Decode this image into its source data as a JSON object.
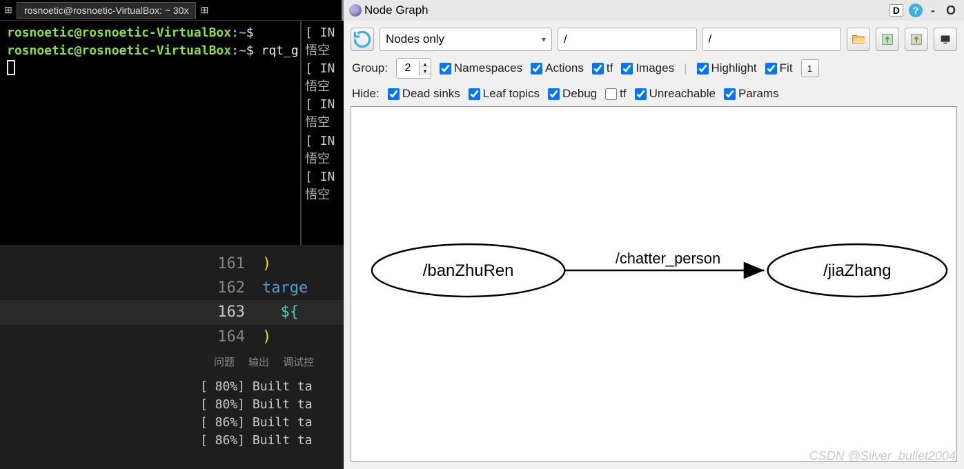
{
  "terminal": {
    "tab_title": "rosnoetic@rosnoetic-VirtualBox: ~ 30x",
    "prompt1_user": "rosnoetic@rosnoetic-VirtualBox",
    "prompt1_path": "~",
    "prompt1_sym": "$",
    "prompt2_user": "rosnoetic@rosnoetic-VirtualBox",
    "prompt2_path": "~",
    "prompt2_sym": "$",
    "cmd": "rqt_graph"
  },
  "side_term": {
    "info": "[ IN",
    "cn": "悟空"
  },
  "editor": {
    "lines": [
      {
        "num": "161",
        "tokens": [
          {
            "cls": "yellow",
            "t": ")"
          }
        ]
      },
      {
        "num": "162",
        "tokens": [
          {
            "cls": "blue",
            "t": "targe"
          }
        ]
      },
      {
        "num": "163",
        "tokens": [
          {
            "cls": "teal",
            "t": "  ${"
          }
        ]
      },
      {
        "num": "164",
        "tokens": [
          {
            "cls": "yellow",
            "t": ")"
          }
        ]
      }
    ],
    "tabs": [
      "问题",
      "输出",
      "调试控"
    ],
    "build": [
      "[ 80%] Built ta",
      "[ 80%] Built ta",
      "[ 86%] Built ta",
      "[ 86%] Built ta"
    ]
  },
  "nodegraph": {
    "title": "Node Graph",
    "title_d": "D",
    "select_label": "Nodes only",
    "filter1": "/",
    "filter2": "/",
    "group_label": "Group:",
    "group_value": "2",
    "checks_row1": {
      "namespaces": "Namespaces",
      "actions": "Actions",
      "tf": "tf",
      "images": "Images",
      "highlight": "Highlight",
      "fit": "Fit"
    },
    "hide_label": "Hide:",
    "checks_row2": {
      "deadsinks": "Dead sinks",
      "leaftopics": "Leaf topics",
      "debug": "Debug",
      "tf": "tf",
      "unreachable": "Unreachable",
      "params": "Params"
    },
    "mini_btn": "1",
    "graph": {
      "node1": "/banZhuRen",
      "node2": "/jiaZhang",
      "edge": "/chatter_person"
    }
  },
  "watermark": "CSDN @Silver_bullet2004"
}
